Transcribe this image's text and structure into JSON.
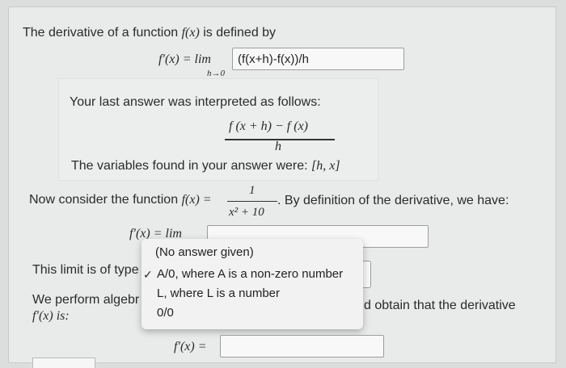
{
  "intro": "The derivative of a function",
  "intro_fx": "f(x)",
  "intro_tail": "is defined by",
  "def_lhs": "f′(x) = lim",
  "def_sub": "h→0",
  "def_input_value": "(f(x+h)-f(x))/h",
  "interp_label": "Your last answer was interpreted as follows:",
  "interp_num": "f (x + h) − f (x)",
  "interp_den": "h",
  "vars_label": "The variables found in your answer were:",
  "vars_value": "[h, x]",
  "consider_pre": "Now consider the function",
  "consider_fx": "f(x) =",
  "consider_num": "1",
  "consider_den": "x² + 10",
  "consider_post": ". By definition of the derivative, we have:",
  "limit_lhs": "f′(x) = lim",
  "limit_type_label": "This limit is of type",
  "algebra_label": "We perform algebr",
  "algebra_tail": "d obtain that the derivative",
  "deriv_is": "f′(x) is:",
  "final_lhs": "f′(x) =",
  "dropdown": {
    "options": [
      {
        "label": "(No answer given)",
        "checked": false
      },
      {
        "label": "A/0, where A is a non-zero number",
        "checked": true
      },
      {
        "label": "L, where L is a number",
        "checked": false
      },
      {
        "label": "0/0",
        "checked": false
      }
    ],
    "check_mark": "✓"
  }
}
